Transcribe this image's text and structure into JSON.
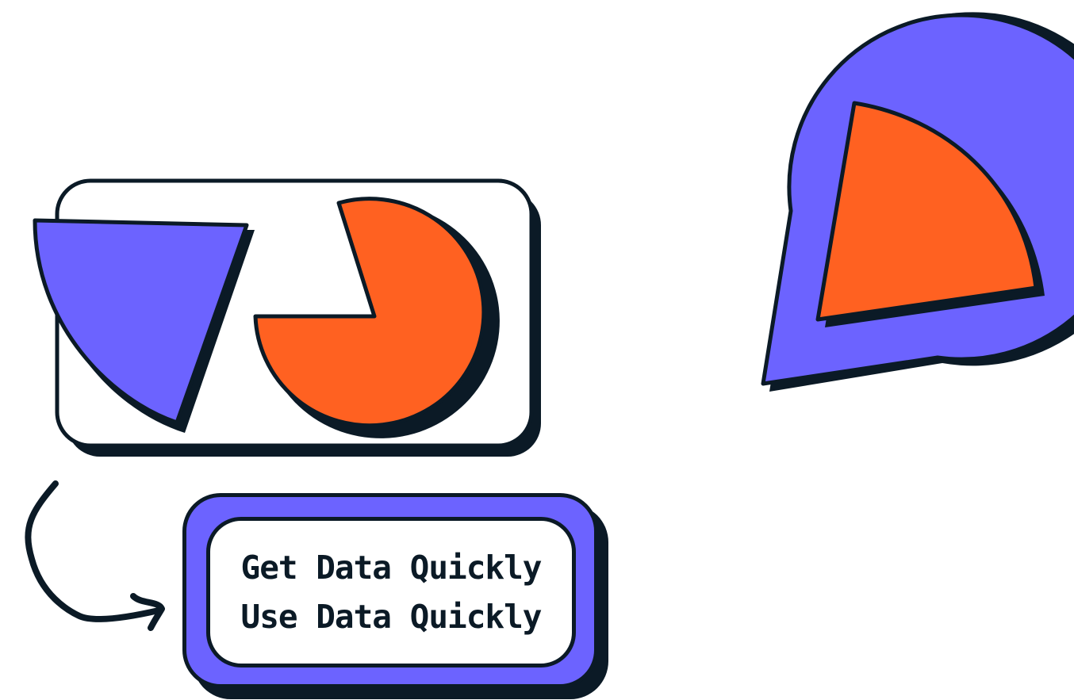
{
  "colors": {
    "ink": "#0b1a26",
    "purple": "#6c63ff",
    "orange": "#ff6121",
    "background": "#ffffff"
  },
  "icons": [
    "curved-arrow-icon"
  ],
  "callout": {
    "line1": "Get Data Quickly",
    "line2": "Use Data Quickly"
  }
}
